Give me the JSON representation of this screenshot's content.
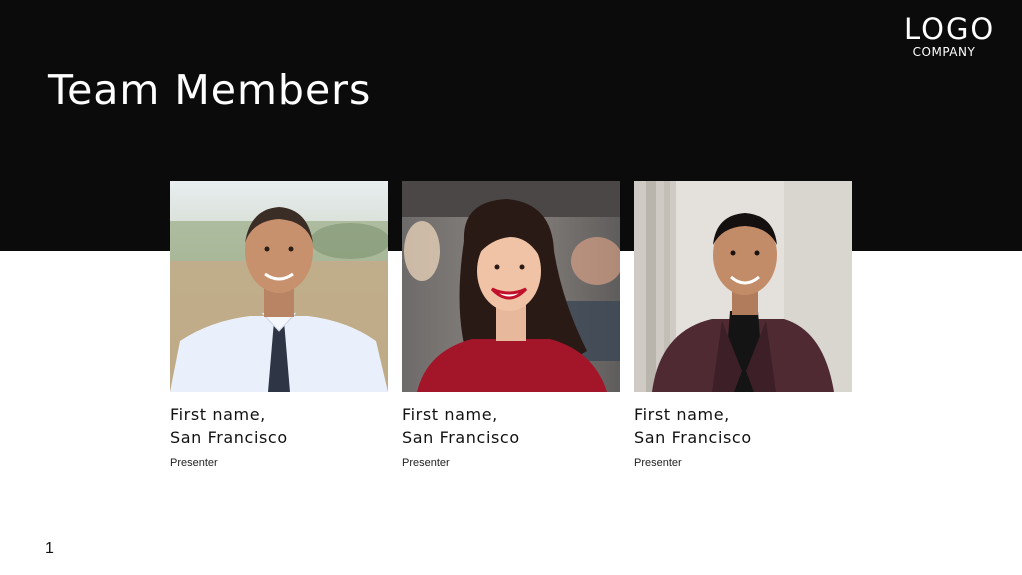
{
  "slide": {
    "title": "Team Members",
    "page_number": "1"
  },
  "logo": {
    "main": "LOGO",
    "sub": "COMPANY"
  },
  "colors": {
    "header_band": "#0b0b0b",
    "background": "#ffffff",
    "header_text": "#ffffff",
    "body_text": "#111111"
  },
  "members": [
    {
      "name_line1": "First name,",
      "name_line2": "San Francisco",
      "role": "Presenter",
      "photo": "portrait-man-white-shirt-tie"
    },
    {
      "name_line1": "First name,",
      "name_line2": "San Francisco",
      "role": "Presenter",
      "photo": "portrait-woman-red-sweater"
    },
    {
      "name_line1": "First name,",
      "name_line2": "San Francisco",
      "role": "Presenter",
      "photo": "portrait-man-burgundy-blazer"
    }
  ]
}
